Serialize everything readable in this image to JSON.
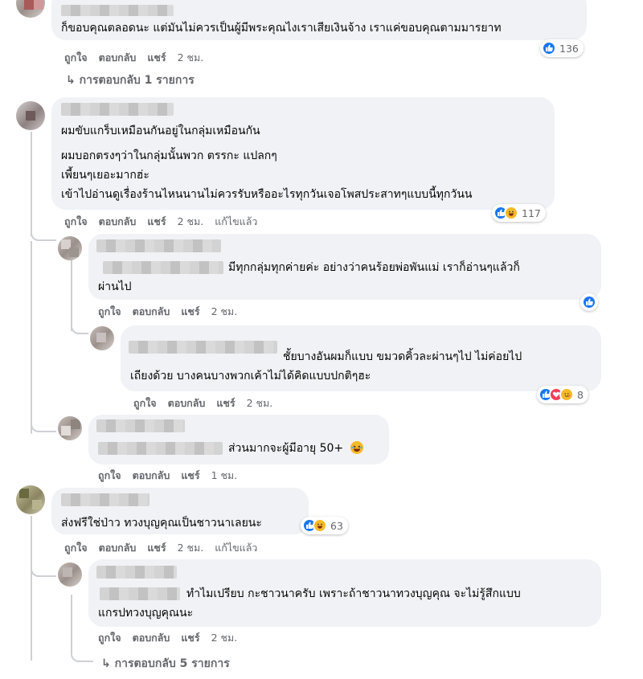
{
  "comments": [
    {
      "text": [
        "ก็ขอบคุณตลอดนะ แต่มันไม่ควรเป็นผู้มีพระคุณไงเราเสียเงินจ้าง เราแค่ขอบคุณตามมารยาท"
      ],
      "actions": {
        "like": "ถูกใจ",
        "reply": "ตอบกลับ",
        "share": "แชร์",
        "time": "2 ชม."
      },
      "reaction_count": "136",
      "replies_link": "การตอบกลับ 1 รายการ"
    },
    {
      "text": [
        "ผมขับแกร็บเหมือนกันอยู่ในกลุ่มเหมือนกัน",
        "ผมบอกตรงๆว่าในกลุ่มนั้นพวก ตรรกะ แปลกๆ",
        "เพี้ยนๆเยอะมากฮ่ะ",
        "เข้าไปอ่านดูเรื่องร้านไหนนานไม่ควรรับหรืออะไรทุกวันเจอโพสประสาทๆแบบนี้ทุกวันน"
      ],
      "actions": {
        "like": "ถูกใจ",
        "reply": "ตอบกลับ",
        "share": "แชร์",
        "time": "2 ชม.",
        "edited": "แก้ไขแล้ว"
      },
      "reaction_count": "117"
    },
    {
      "text": [
        "มีทุกกลุ่มทุกค่ายค่ะ อย่างว่าคนร้อยพ่อพันแม่ เราก็อ่านๆแล้วก็",
        "ผ่านไป"
      ],
      "actions": {
        "like": "ถูกใจ",
        "reply": "ตอบกลับ",
        "share": "แชร์",
        "time": "2 ชม."
      }
    },
    {
      "text": [
        "ชั้ยบางอันผมก็แบบ ขมวดคิ้วละผ่านๆไป ไม่ค่อยไป",
        "เถียงด้วย บางคนบางพวกเค้าไม่ได้คิดแบบปกติๆฮะ"
      ],
      "actions": {
        "like": "ถูกใจ",
        "reply": "ตอบกลับ",
        "share": "แชร์",
        "time": "2 ชม."
      },
      "reaction_count": "8"
    },
    {
      "text": [
        "ส่วนมากจะผู้มีอายุ 50+"
      ],
      "actions": {
        "like": "ถูกใจ",
        "reply": "ตอบกลับ",
        "share": "แชร์",
        "time": "1 ชม."
      }
    },
    {
      "text": [
        "ส่งฟรีใช่ป่าว ทวงบุญคุณเป็นชาวนาเลยนะ"
      ],
      "actions": {
        "like": "ถูกใจ",
        "reply": "ตอบกลับ",
        "share": "แชร์",
        "time": "2 ชม.",
        "edited": "แก้ไขแล้ว"
      },
      "reaction_count": "63"
    },
    {
      "text": [
        "ทำไมเปรียบ กะชาวนาครับ เพราะถ้าชาวนาทวงบุญคุณ จะไม่รู้สึกแบบ",
        "แกรปทวงบุญคุณนะ"
      ],
      "actions": {
        "like": "ถูกใจ",
        "reply": "ตอบกลับ",
        "share": "แชร์",
        "time": "2 ชม."
      },
      "replies_link": "การตอบกลับ 5 รายการ"
    }
  ],
  "icons": {
    "like": "thumbs-up-icon",
    "haha": "laughing-face-icon",
    "love": "heart-icon",
    "care": "care-face-icon",
    "reply_arrow": "reply-arrow-icon"
  },
  "colors": {
    "bubble": "#f0f2f5",
    "like_blue": "#1877f2",
    "meta_gray": "#65676b"
  }
}
